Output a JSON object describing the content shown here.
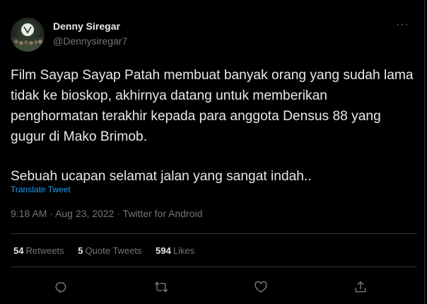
{
  "user": {
    "display_name": "Denny Siregar",
    "handle": "@Dennysiregar7"
  },
  "more_label": "···",
  "tweet": {
    "paragraphs": [
      "Film Sayap Sayap Patah membuat banyak orang yang sudah lama tidak ke bioskop, akhirnya datang untuk memberikan penghormatan terakhir kepada para anggota Densus 88 yang gugur di Mako Brimob.",
      "Sebuah ucapan selamat jalan yang sangat indah.."
    ],
    "translate_label": "Translate Tweet"
  },
  "meta": {
    "time": "9:18 AM",
    "separator": " · ",
    "date": "Aug 23, 2022",
    "source": "Twitter for Android"
  },
  "stats": {
    "retweets_count": "54",
    "retweets_label": "Retweets",
    "quotes_count": "5",
    "quotes_label": "Quote Tweets",
    "likes_count": "594",
    "likes_label": "Likes"
  },
  "actions": {
    "icons": [
      "reply-icon",
      "retweet-icon",
      "like-icon",
      "share-icon"
    ],
    "icon_color": "#71767b"
  },
  "colors": {
    "background": "#000000",
    "text": "#e7e9ea",
    "muted": "#71767b",
    "link": "#1d9bf0",
    "border": "#2f3336"
  }
}
